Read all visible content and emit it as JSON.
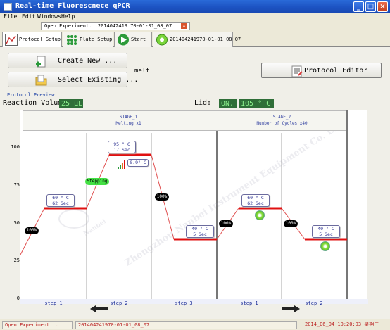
{
  "window": {
    "title": "Real-time Fluorescnece qPCR"
  },
  "menu": [
    "File",
    "Edit",
    "Windows",
    "Help"
  ],
  "doc_tab": {
    "label": "Open Experiment...2014042419 70-01-01_08_07"
  },
  "tabs": [
    {
      "label": "Protocol Setup",
      "icon": "chart-icon"
    },
    {
      "label": "Plate Setup",
      "icon": "grid-icon"
    },
    {
      "label": "Start",
      "icon": "play-icon"
    },
    {
      "label": "201404241970-01-01_08_07",
      "icon": "flower-icon"
    }
  ],
  "buttons": {
    "create_new": "Create New ...",
    "select_existing": "Select Existing ...",
    "protocol_editor": "Protocol Editor"
  },
  "protocol_name": "melt",
  "preview_title": "Protocol Preview",
  "reaction_volume": {
    "label": "Reaction Volume:",
    "value": "25 µL"
  },
  "lid": {
    "label": "Lid:",
    "state": "ON.",
    "temp": "105 ° C"
  },
  "chart": {
    "y_ticks": [
      "100",
      "75",
      "50",
      "25",
      "0"
    ],
    "stages": [
      {
        "name": "STAGE_1",
        "subtitle": "Melting x1"
      },
      {
        "name": "STAGE_2",
        "subtitle": "Number of Cycles x40"
      }
    ],
    "steps": [
      {
        "label": "step 1",
        "temp": "60 ° C",
        "time": "62 Sec",
        "ramp": "100%"
      },
      {
        "label": "step 2",
        "temp": "95 ° C",
        "time": "17 Sec",
        "ramp": "Stepping",
        "increment": "0.9° C"
      },
      {
        "label": "step 3",
        "temp": "40 ° C",
        "time": "5 Sec",
        "ramp": "100%"
      },
      {
        "label": "step 1",
        "temp": "60 ° C",
        "time": "62 Sec",
        "ramp": "100%"
      },
      {
        "label": "step 2",
        "temp": "40 ° C",
        "time": "5 Sec",
        "ramp": "100%"
      }
    ],
    "watermark": "Zhengzhou Nanbei Instrument Equipment Co. Ltd.",
    "watermark_logo": "Nanbei"
  },
  "status": {
    "left": "Open Experiment...",
    "file": "201404241970-01-01_08_07",
    "time": "2014_06_04 10:20:03 星期三"
  }
}
